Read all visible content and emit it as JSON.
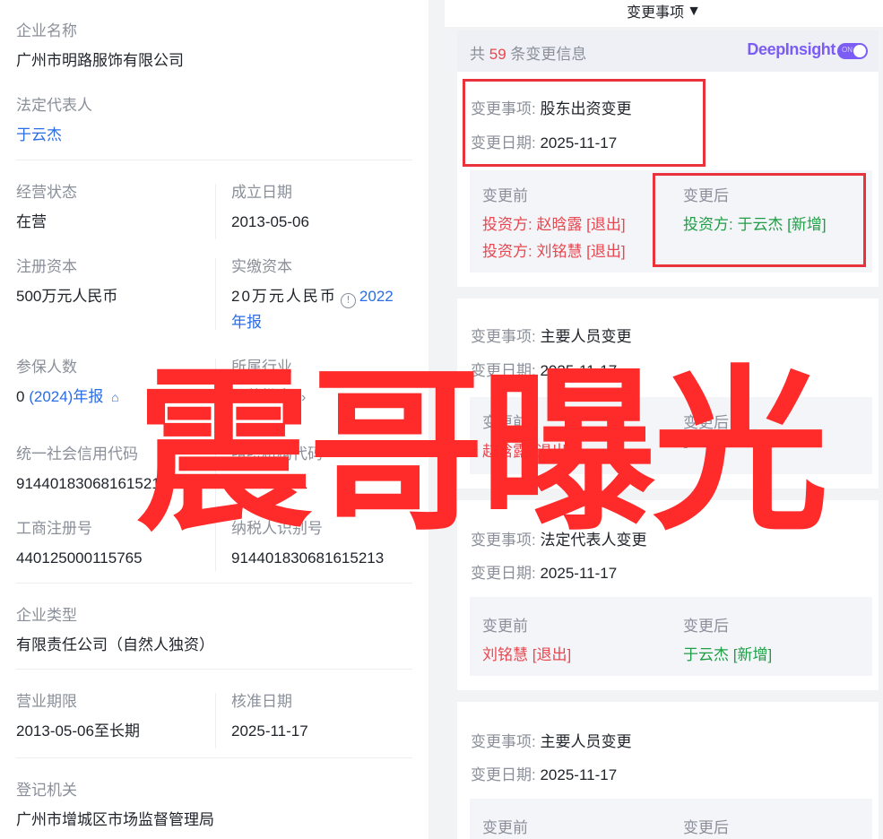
{
  "company": {
    "name_label": "企业名称",
    "name": "广州市明路服饰有限公司",
    "legal_rep_label": "法定代表人",
    "legal_rep": "于云杰",
    "status_label": "经营状态",
    "status": "在营",
    "founded_label": "成立日期",
    "founded": "2013-05-06",
    "reg_capital_label": "注册资本",
    "reg_capital": "500万元人民币",
    "paid_capital_label": "实缴资本",
    "paid_capital": "20万元人民币",
    "paid_capital_link_1": "2022",
    "paid_capital_link_2": "年报",
    "insured_label": "参保人数",
    "insured_value": "0",
    "insured_link": "(2024)年报",
    "industry_label": "所属行业",
    "industry": "服装批发",
    "credit_code_label": "统一社会信用代码",
    "credit_code": "91440183068161521​3",
    "org_code_label": "组织机构代码",
    "org_code": "068161521",
    "biz_reg_label": "工商注册号",
    "biz_reg": "440125000115765",
    "taxpayer_label": "纳税人识别号",
    "taxpayer": "914401830681615213",
    "type_label": "企业类型",
    "type": "有限责任公司（自然人独资）",
    "term_label": "营业期限",
    "term": "2013-05-06至长期",
    "approval_label": "核准日期",
    "approval": "2025-11-17",
    "authority_label": "登记机关",
    "authority": "广州市增城区市场监督管理局"
  },
  "changes": {
    "filter_label": "变更事项",
    "count_prefix": "共",
    "count": "59",
    "count_suffix": "条变更信息",
    "brand": "DeepInsight",
    "toggle_text": "ON",
    "item_key": "变更事项:",
    "date_key": "变更日期:",
    "before_label": "变更前",
    "after_label": "变更后",
    "items": [
      {
        "item": "股东出资变更",
        "date": "2025-11-17",
        "before": [
          "投资方: 赵晗露 [退出]",
          "投资方: 刘铭慧 [退出]"
        ],
        "after": [
          "投资方: 于云杰 [新增]"
        ]
      },
      {
        "item": "主要人员变更",
        "date": "2025-11-17",
        "before": [
          "赵晗露 [退出]"
        ],
        "after": [
          "-"
        ]
      },
      {
        "item": "法定代表人变更",
        "date": "2025-11-17",
        "before": [
          "刘铭慧 [退出]"
        ],
        "after": [
          "于云杰 [新增]"
        ]
      },
      {
        "item": "主要人员变更",
        "date": "2025-11-17"
      }
    ]
  },
  "watermark": "震哥曝光",
  "colors": {
    "accent_blue": "#2b6de5",
    "exit_red": "#e8474f",
    "new_green": "#1f9e46",
    "highlight_box": "#e8323c",
    "watermark": "#ff2a2a",
    "brand_purple": "#7b5cf5"
  }
}
